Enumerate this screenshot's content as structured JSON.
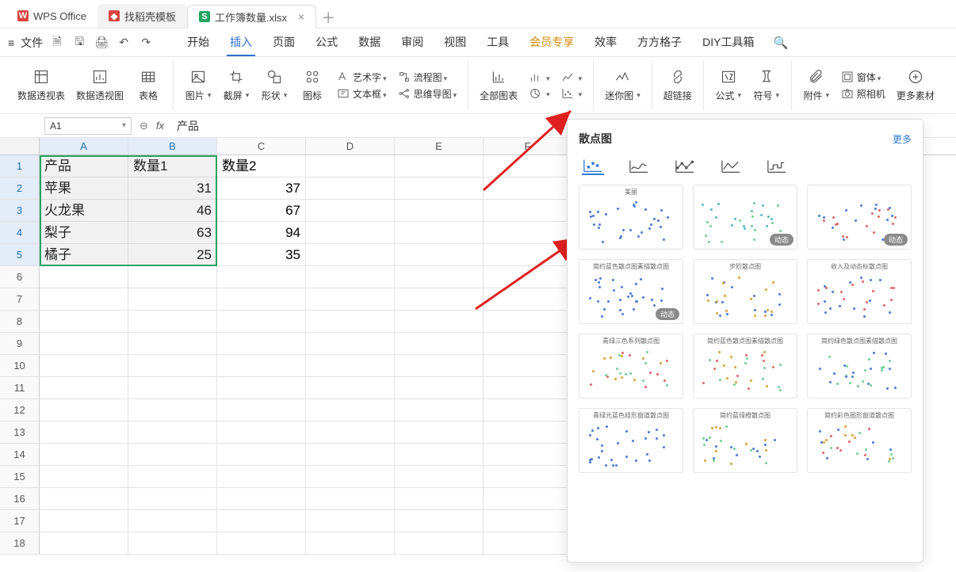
{
  "tabs": {
    "app": "WPS Office",
    "template": "找稻壳模板",
    "workbook": "工作簿数量.xlsx"
  },
  "menu": {
    "file": "文件",
    "items": [
      "开始",
      "插入",
      "页面",
      "公式",
      "数据",
      "审阅",
      "视图",
      "工具",
      "会员专享",
      "效率",
      "方方格子",
      "DIY工具箱"
    ],
    "active_index": 1
  },
  "ribbon": {
    "pivot_table": "数据透视表",
    "pivot_chart": "数据透视图",
    "table": "表格",
    "picture": "图片",
    "screenshot": "截屏",
    "shape": "形状",
    "icon": "图标",
    "wordart": "艺术字",
    "textbox": "文本框",
    "flowchart": "流程图",
    "mindmap": "思维导图",
    "all_charts": "全部图表",
    "sparkline": "迷你图",
    "hyperlink": "超链接",
    "formula": "公式",
    "symbol": "符号",
    "attachment": "附件",
    "camera": "照相机",
    "window": "窗体",
    "more": "更多素材"
  },
  "namebox": {
    "ref": "A1",
    "formula": "产品"
  },
  "sheet": {
    "cols": [
      "A",
      "B",
      "C",
      "D",
      "E",
      "F"
    ],
    "sel_cols": [
      0,
      1
    ],
    "rows": [
      {
        "r": "1",
        "sel": true,
        "cells": [
          "产品",
          "数量1",
          "数量2",
          "",
          "",
          ""
        ]
      },
      {
        "r": "2",
        "sel": true,
        "cells": [
          "苹果",
          "31",
          "37",
          "",
          "",
          ""
        ]
      },
      {
        "r": "3",
        "sel": true,
        "cells": [
          "火龙果",
          "46",
          "67",
          "",
          "",
          ""
        ]
      },
      {
        "r": "4",
        "sel": true,
        "cells": [
          "梨子",
          "63",
          "94",
          "",
          "",
          ""
        ]
      },
      {
        "r": "5",
        "sel": true,
        "cells": [
          "橘子",
          "25",
          "35",
          "",
          "",
          ""
        ]
      },
      {
        "r": "6",
        "cells": [
          "",
          "",
          "",
          "",
          "",
          ""
        ]
      },
      {
        "r": "7",
        "cells": [
          "",
          "",
          "",
          "",
          "",
          ""
        ]
      },
      {
        "r": "8",
        "cells": [
          "",
          "",
          "",
          "",
          "",
          ""
        ]
      },
      {
        "r": "9",
        "cells": [
          "",
          "",
          "",
          "",
          "",
          ""
        ]
      },
      {
        "r": "10",
        "cells": [
          "",
          "",
          "",
          "",
          "",
          ""
        ]
      },
      {
        "r": "11",
        "cells": [
          "",
          "",
          "",
          "",
          "",
          ""
        ]
      },
      {
        "r": "12",
        "cells": [
          "",
          "",
          "",
          "",
          "",
          ""
        ]
      },
      {
        "r": "13",
        "cells": [
          "",
          "",
          "",
          "",
          "",
          ""
        ]
      },
      {
        "r": "14",
        "cells": [
          "",
          "",
          "",
          "",
          "",
          ""
        ]
      },
      {
        "r": "15",
        "cells": [
          "",
          "",
          "",
          "",
          "",
          ""
        ]
      },
      {
        "r": "16",
        "cells": [
          "",
          "",
          "",
          "",
          "",
          ""
        ]
      },
      {
        "r": "17",
        "cells": [
          "",
          "",
          "",
          "",
          "",
          ""
        ]
      },
      {
        "r": "18",
        "cells": [
          "",
          "",
          "",
          "",
          "",
          ""
        ]
      }
    ]
  },
  "panel": {
    "title": "散点图",
    "more": "更多",
    "badge": "动态",
    "thumb_titles": [
      "美丽",
      "",
      "",
      "简约蓝色散点图素描散点图",
      "步阶散点图",
      "收入及动态标散点图",
      "青绿三色系列散点图",
      "简约蓝色散点图素描散点图",
      "简约绿色散点图素描散点图",
      "青绿元蓝色组形窗道散点图",
      "简约蓝绿橙散点图",
      "简约彩色图形窗道散点图"
    ]
  },
  "chart_data": {
    "type": "table",
    "columns": [
      "产品",
      "数量1",
      "数量2"
    ],
    "rows": [
      [
        "苹果",
        31,
        37
      ],
      [
        "火龙果",
        46,
        67
      ],
      [
        "梨子",
        63,
        94
      ],
      [
        "橘子",
        25,
        35
      ]
    ]
  }
}
